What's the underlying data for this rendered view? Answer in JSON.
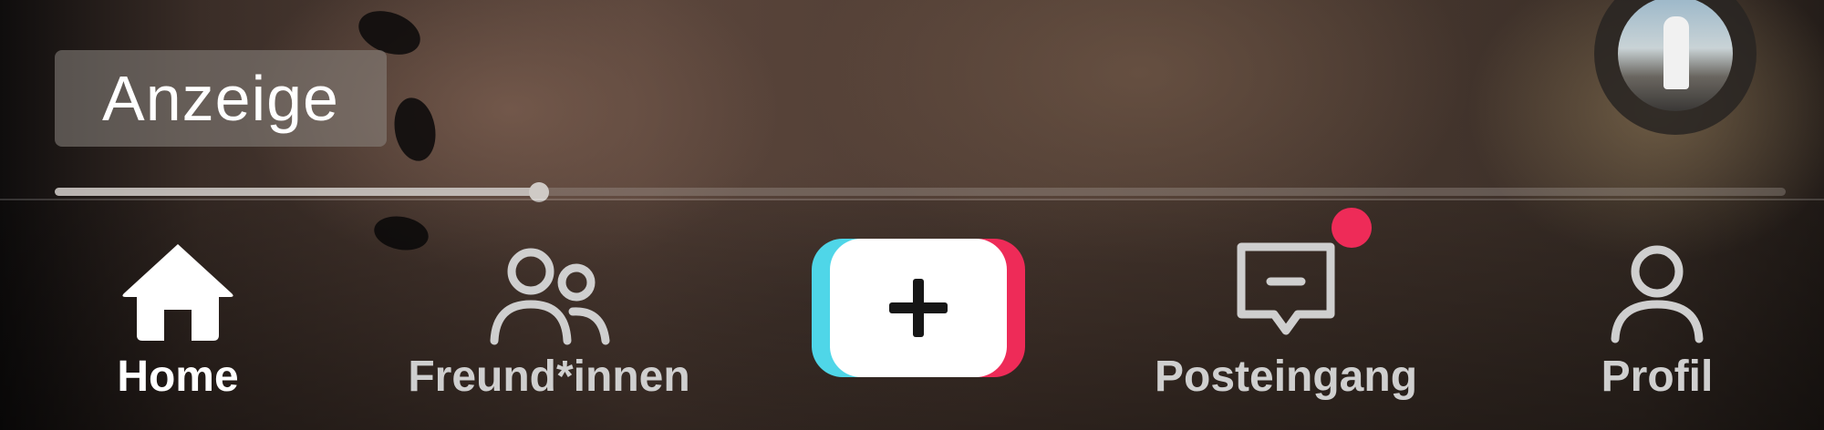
{
  "ad": {
    "label": "Anzeige"
  },
  "video": {
    "progress": 0.28
  },
  "colors": {
    "create_cyan": "#4fd6e8",
    "create_pink": "#ee2b58",
    "notification_dot": "#ee2b58",
    "active_label": "#ffffff",
    "inactive_label": "#cfcfcf"
  },
  "navbar": {
    "tabs": [
      {
        "label": "Home",
        "icon": "home-icon",
        "active": true
      },
      {
        "label": "Freund*innen",
        "icon": "friends-icon",
        "active": false
      },
      {
        "label": "",
        "icon": "plus-icon",
        "active": false
      },
      {
        "label": "Posteingang",
        "icon": "inbox-icon",
        "active": false,
        "has_notification": true
      },
      {
        "label": "Profil",
        "icon": "profile-icon",
        "active": false
      }
    ]
  }
}
